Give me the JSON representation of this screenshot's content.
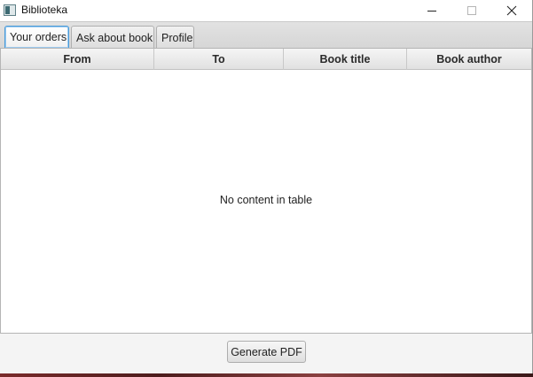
{
  "window": {
    "title": "Biblioteka"
  },
  "tabs": [
    {
      "label": "Your orders",
      "active": true
    },
    {
      "label": "Ask about book",
      "active": false
    },
    {
      "label": "Profile",
      "active": false
    }
  ],
  "table": {
    "columns": [
      "From",
      "To",
      "Book title",
      "Book author"
    ],
    "rows": [],
    "placeholder": "No content in table"
  },
  "actions": {
    "generate_pdf_label": "Generate PDF"
  },
  "colors": {
    "active_tab_border": "#4a9bd8",
    "background": "#f4f4f4"
  },
  "icons": {
    "app": "app-window-icon",
    "minimize": "minimize-icon",
    "maximize": "maximize-icon",
    "close": "close-icon"
  }
}
